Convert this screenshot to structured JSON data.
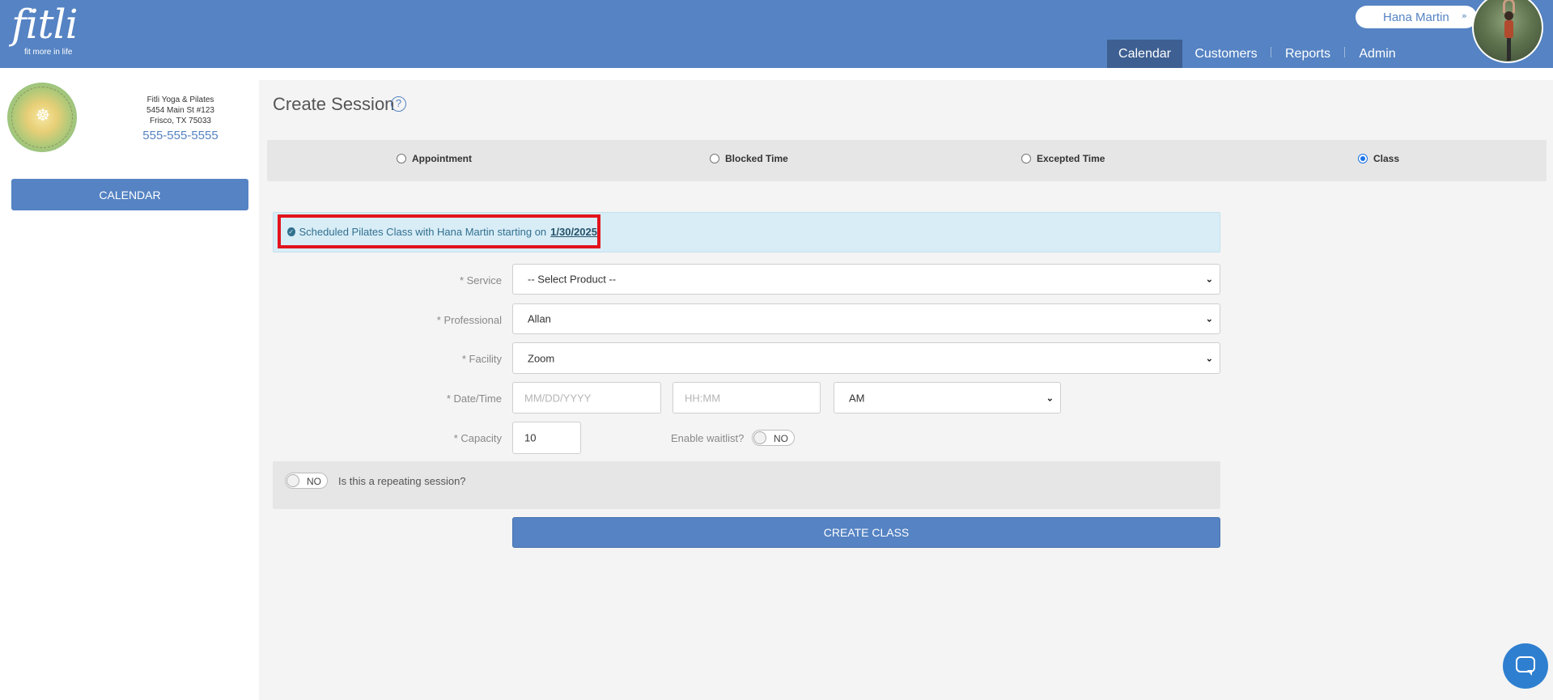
{
  "app": {
    "logo_text": "fitli",
    "logo_tagline": "fit more in life"
  },
  "user": {
    "name": "Hana Martin",
    "menu_chevron": "»"
  },
  "nav": {
    "items": [
      {
        "label": "Calendar",
        "active": true
      },
      {
        "label": "Customers",
        "active": false
      },
      {
        "label": "Reports",
        "active": false
      },
      {
        "label": "Admin",
        "active": false
      }
    ]
  },
  "business": {
    "name": "Fitli Yoga & Pilates",
    "address_line1": "5454 Main St #123",
    "address_line2": "Frisco, TX 75033",
    "phone": "555-555-5555"
  },
  "sidebar": {
    "calendar_button": "CALENDAR"
  },
  "page": {
    "title": "Create Session",
    "help_icon": "?"
  },
  "session_types": [
    {
      "label": "Appointment",
      "checked": false
    },
    {
      "label": "Blocked Time",
      "checked": false
    },
    {
      "label": "Excepted Time",
      "checked": false
    },
    {
      "label": "Class",
      "checked": true
    }
  ],
  "alert": {
    "message": "Scheduled Pilates Class with Hana Martin starting on",
    "date": "1/30/2025",
    "icon": "✓"
  },
  "form": {
    "service": {
      "label": "* Service",
      "value": "-- Select Product --"
    },
    "professional": {
      "label": "* Professional",
      "value": "Allan"
    },
    "facility": {
      "label": "* Facility",
      "value": "Zoom"
    },
    "datetime": {
      "label": "* Date/Time",
      "date_placeholder": "MM/DD/YYYY",
      "time_placeholder": "HH:MM",
      "ampm_value": "AM"
    },
    "capacity": {
      "label": "* Capacity",
      "value": "10"
    },
    "waitlist": {
      "label": "Enable waitlist?",
      "toggle": "NO"
    },
    "repeating": {
      "label": "Is this a repeating session?",
      "toggle": "NO"
    },
    "submit_label": "CREATE CLASS"
  },
  "icons": {
    "select_chevron": "⌄",
    "chat": "chat-icon"
  },
  "colors": {
    "brand": "#5583c3",
    "nav_active": "#3d5f92",
    "alert_bg": "#d9edf7",
    "alert_highlight": "#e2141d",
    "chat": "#2f7fd0"
  }
}
